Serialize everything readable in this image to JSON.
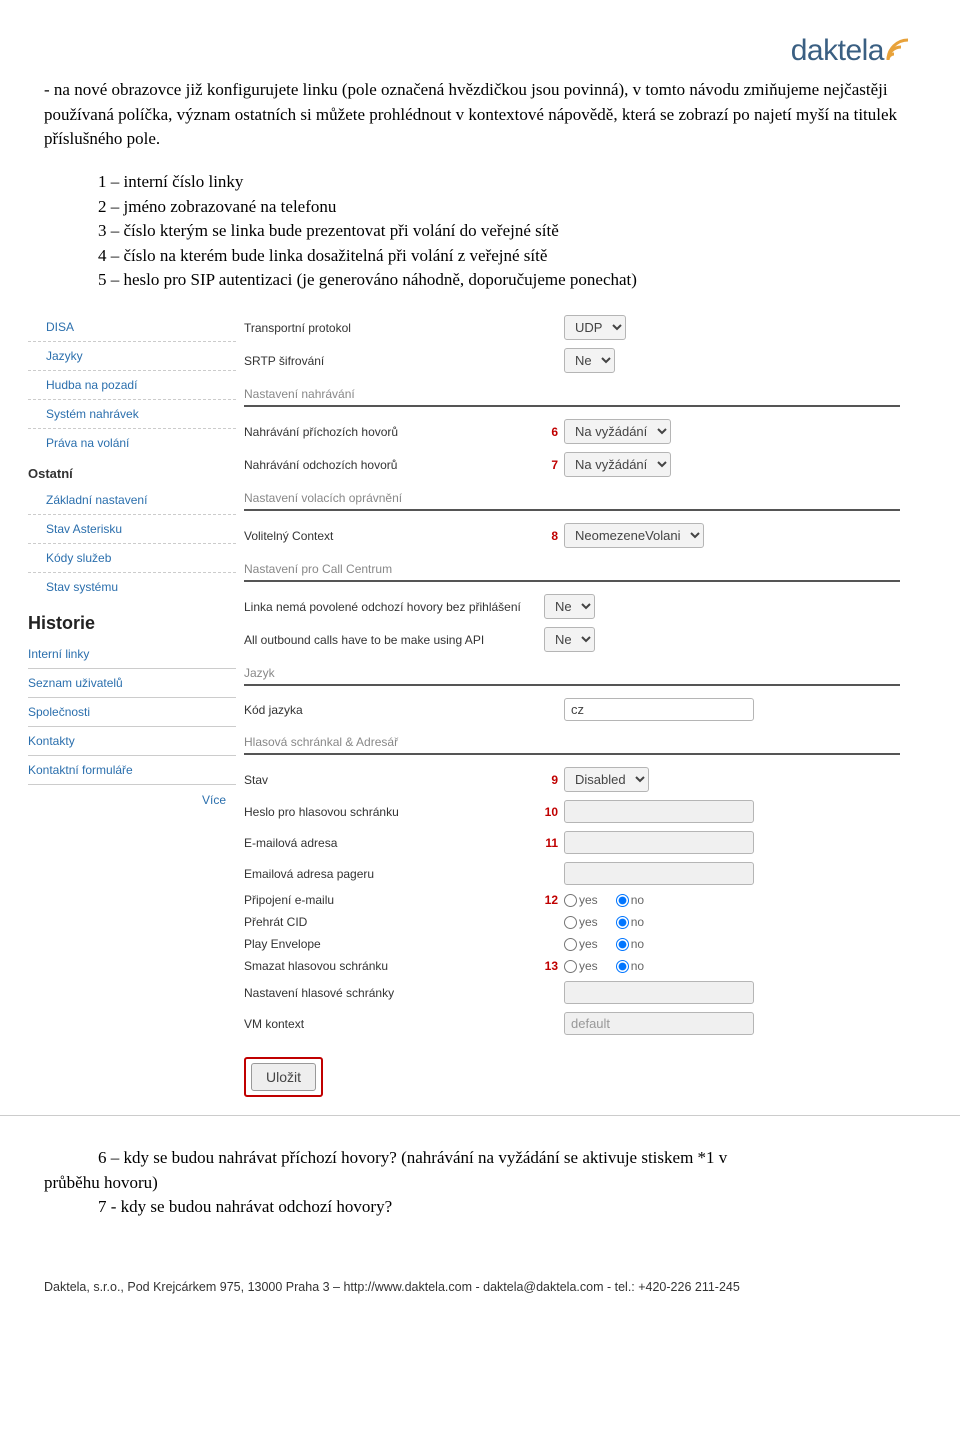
{
  "logo": {
    "text": "daktela"
  },
  "intro": "- na nové obrazovce již konfigurujete linku (pole označená hvězdičkou jsou povinná), v tomto návodu zmiňujeme nejčastěji používaná políčka, význam ostatních si můžete prohlédnout v kontextové nápovědě, která se zobrazí po najetí myší na titulek příslušného pole.",
  "list": {
    "i1": "1 – interní číslo linky",
    "i2": "2 – jméno zobrazované na telefonu",
    "i3": "3 – číslo kterým se linka bude prezentovat při volání do veřejné sítě",
    "i4": "4 – číslo na kterém bude linka dosažitelná při volání z veřejné sítě",
    "i5": "5 – heslo pro SIP autentizaci (je generováno náhodně, doporučujeme ponechat)"
  },
  "sidebar": {
    "disa": "DISA",
    "jazyky": "Jazyky",
    "hudba": "Hudba na pozadí",
    "nahravky": "Systém nahrávek",
    "prava": "Práva na volání",
    "ostatni": "Ostatní",
    "zakladni": "Základní nastavení",
    "asterisk": "Stav Asterisku",
    "kody": "Kódy služeb",
    "systemu": "Stav systému",
    "historie": "Historie",
    "interni": "Interní linky",
    "seznam": "Seznam uživatelů",
    "spolecnosti": "Společnosti",
    "kontakty": "Kontakty",
    "formulare": "Kontaktní formuláře",
    "vice": "Více"
  },
  "form": {
    "transport_lbl": "Transportní protokol",
    "transport_val": "UDP",
    "srtp_lbl": "SRTP šifrování",
    "srtp_val": "Ne",
    "sec_nahravani": "Nastavení nahrávání",
    "nahr_prichozi_lbl": "Nahrávání příchozích hovorů",
    "nahr_prichozi_val": "Na vyžádání",
    "nahr_odchozi_lbl": "Nahrávání odchozích hovorů",
    "nahr_odchozi_val": "Na vyžádání",
    "sec_opravneni": "Nastavení volacích oprávnění",
    "context_lbl": "Volitelný Context",
    "context_val": "NeomezeneVolani",
    "sec_callcentrum": "Nastavení pro Call Centrum",
    "bezprihlaseni_lbl": "Linka nemá povolené odchozí hovory bez přihlášení",
    "bezprihlaseni_val": "Ne",
    "api_lbl": "All outbound calls have to be make using API",
    "api_val": "Ne",
    "sec_jazyk": "Jazyk",
    "kodjazyka_lbl": "Kód jazyka",
    "kodjazyka_val": "cz",
    "sec_hlasova": "Hlasová schránkal & Adresář",
    "stav_lbl": "Stav",
    "stav_val": "Disabled",
    "hesloschranka_lbl": "Heslo pro hlasovou schránku",
    "email_lbl": "E-mailová adresa",
    "pager_lbl": "Emailová adresa pageru",
    "pripojeni_lbl": "Připojení e-mailu",
    "prehrat_lbl": "Přehrát CID",
    "envelope_lbl": "Play Envelope",
    "smazat_lbl": "Smazat hlasovou schránku",
    "nastavenischranky_lbl": "Nastavení hlasové schránky",
    "vmkontext_lbl": "VM kontext",
    "vmkontext_val": "default",
    "yes": "yes",
    "no": "no",
    "ulozit": "Uložit",
    "n6": "6",
    "n7": "7",
    "n8": "8",
    "n9": "9",
    "n10": "10",
    "n11": "11",
    "n12": "12",
    "n13": "13"
  },
  "after": {
    "l1": "6 – kdy se budou nahrávat příchozí hovory? (nahrávání na vyžádání se aktivuje stiskem *1 v",
    "l1b": "průběhu hovoru)",
    "l2": "7 - kdy se budou nahrávat odchozí hovory?"
  },
  "footer": "Daktela, s.r.o., Pod Krejcárkem 975, 13000 Praha 3 – http://www.daktela.com - daktela@daktela.com - tel.: +420-226 211-245"
}
